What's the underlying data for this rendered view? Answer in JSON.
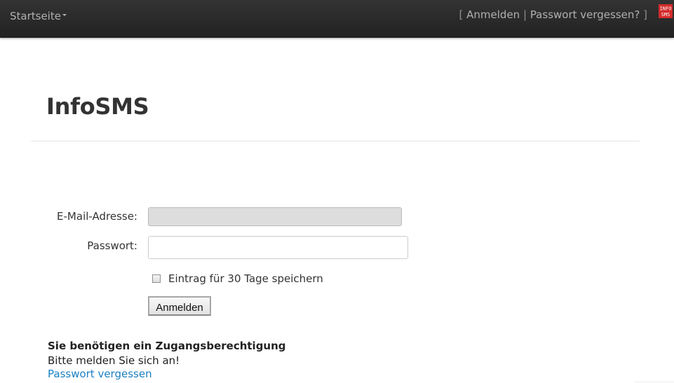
{
  "navbar": {
    "brand": "Startseite",
    "bracket_open": "[",
    "login_link": "Anmelden",
    "separator": "|",
    "forgot_link": "Passwort vergessen?",
    "bracket_close": "]",
    "logo_text_top": "INFO",
    "logo_text_bottom": "SMS",
    "logo_color": "#d42a2a"
  },
  "page": {
    "title": "InfoSMS"
  },
  "form": {
    "email_label": "E-Mail-Adresse:",
    "email_value": "",
    "password_label": "Passwort:",
    "password_value": "",
    "remember_label": "Eintrag für 30 Tage speichern",
    "remember_checked": false,
    "submit_label": "Anmelden"
  },
  "notice": {
    "title": "Sie benötigen ein Zugangsberechtigung",
    "text": "Bitte melden Sie sich an!",
    "link": "Passwort vergessen",
    "link_color": "#1a7fc0"
  }
}
